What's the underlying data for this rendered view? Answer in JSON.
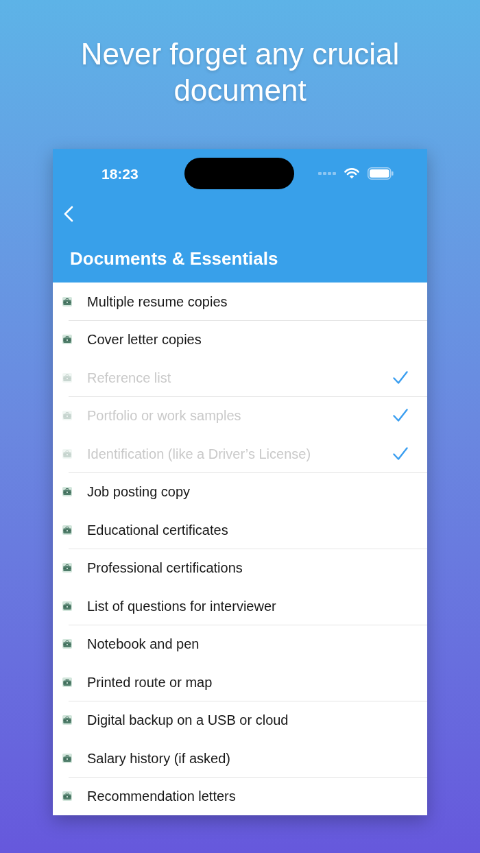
{
  "headline": "Never forget any crucial document",
  "status_bar": {
    "time": "18:23"
  },
  "nav": {
    "title": "Documents & Essentials"
  },
  "items": [
    {
      "label": "Multiple resume copies",
      "checked": false
    },
    {
      "label": "Cover letter copies",
      "checked": false
    },
    {
      "label": "Reference list",
      "checked": true
    },
    {
      "label": "Portfolio or work samples",
      "checked": true
    },
    {
      "label": "Identification (like a Driver’s License)",
      "checked": true
    },
    {
      "label": "Job posting copy",
      "checked": false
    },
    {
      "label": "Educational certificates",
      "checked": false
    },
    {
      "label": "Professional certifications",
      "checked": false
    },
    {
      "label": "List of questions for interviewer",
      "checked": false
    },
    {
      "label": "Notebook and pen",
      "checked": false
    },
    {
      "label": "Printed route or map",
      "checked": false
    },
    {
      "label": "Digital backup on a USB or cloud",
      "checked": false
    },
    {
      "label": "Salary history (if asked)",
      "checked": false
    },
    {
      "label": "Recommendation letters",
      "checked": false
    }
  ]
}
